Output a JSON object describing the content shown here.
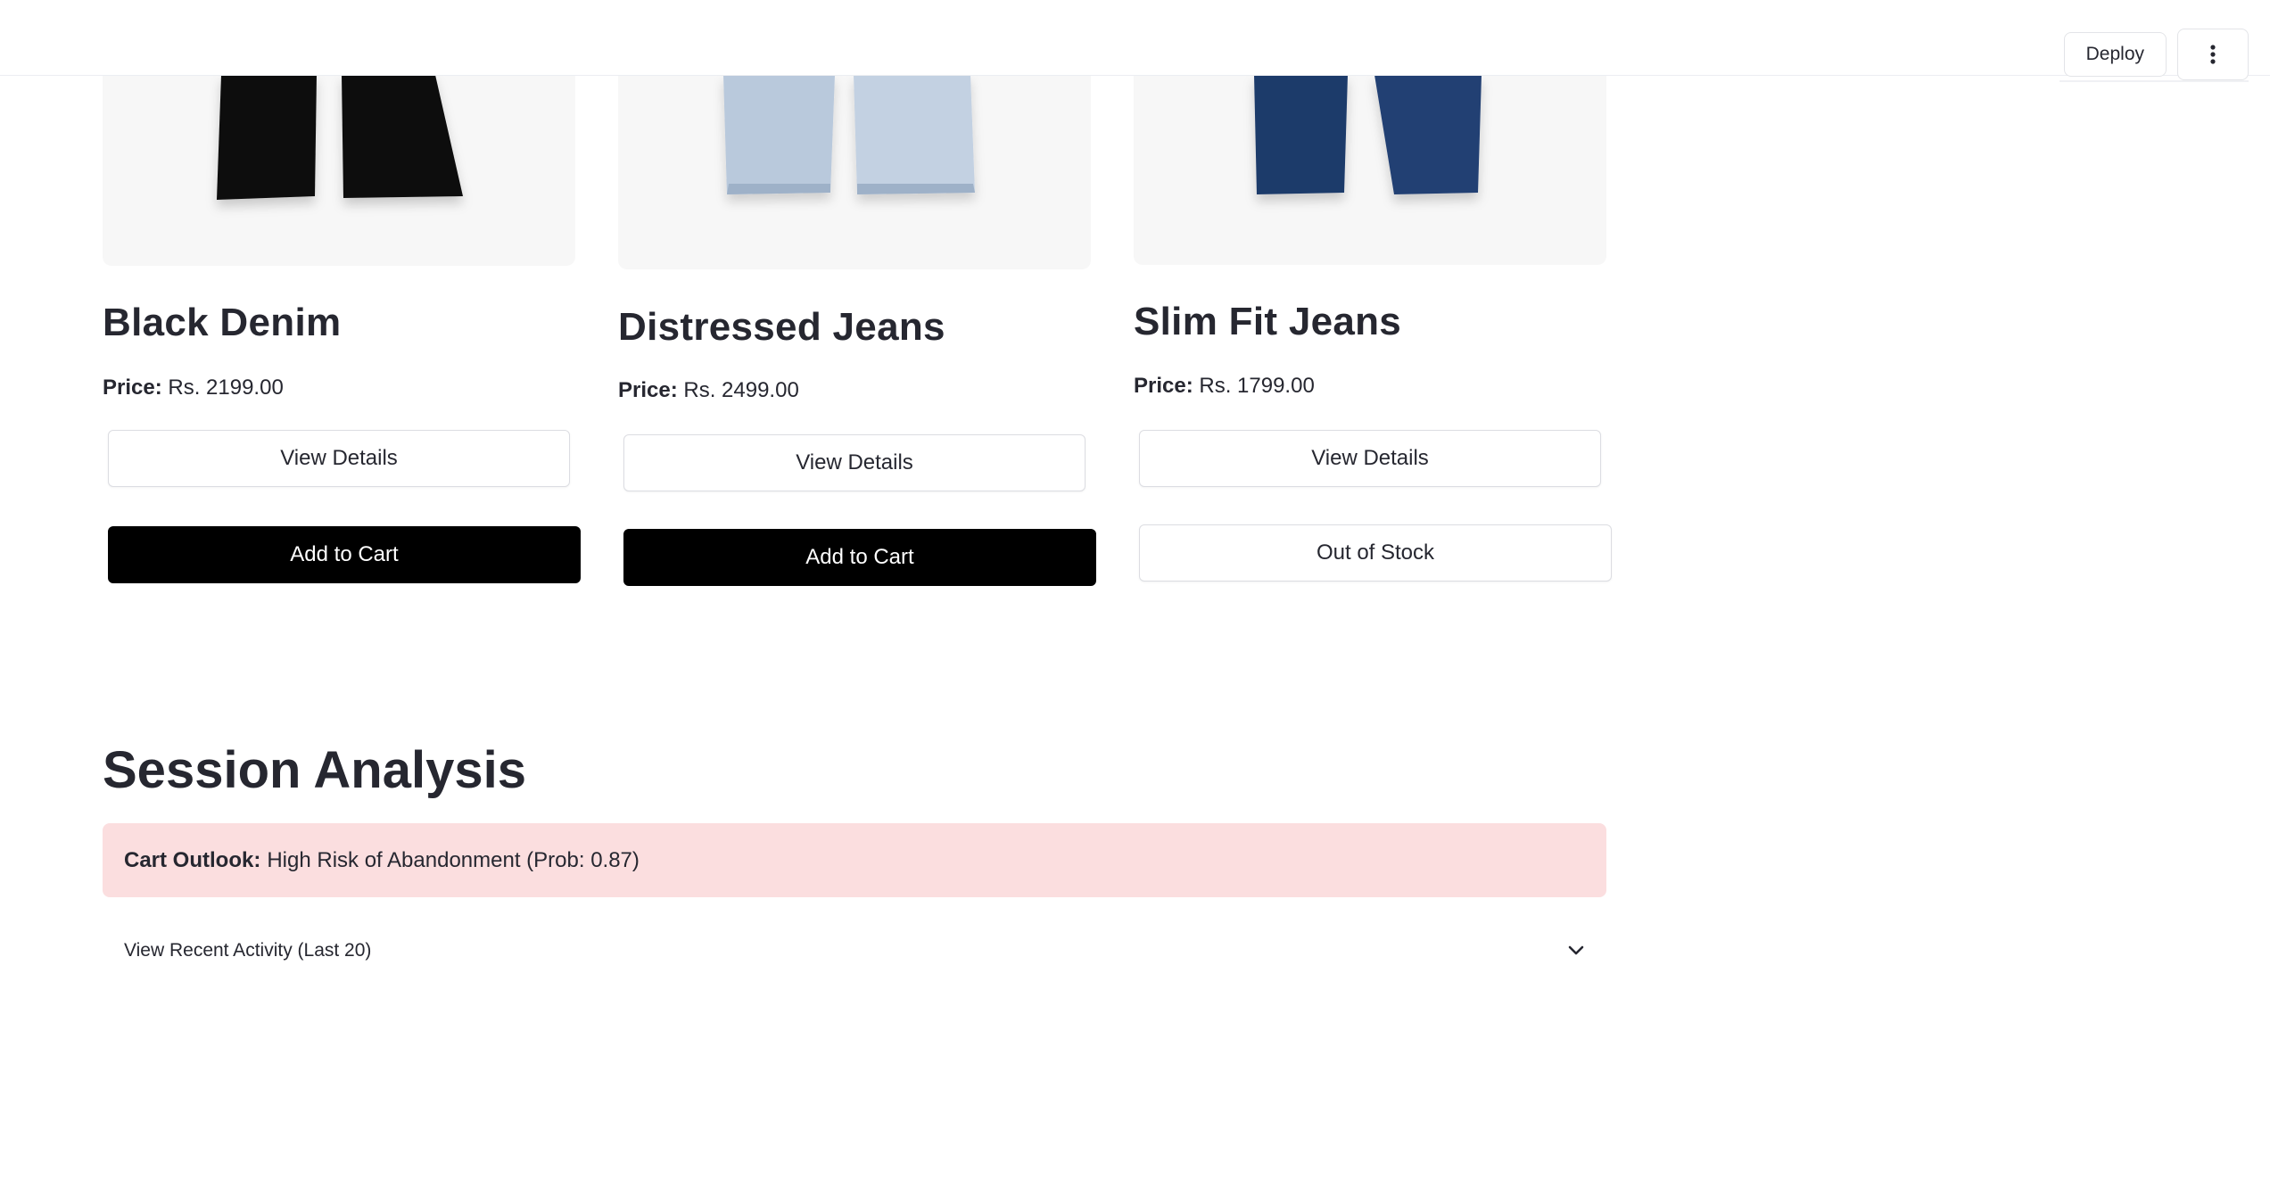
{
  "header": {
    "deploy_label": "Deploy",
    "menu_icon": "vertical-ellipsis-icon"
  },
  "products": [
    {
      "name": "Black Denim",
      "price_label": "Price:",
      "price_value": "Rs. 2199.00",
      "view_label": "View Details",
      "action_label": "Add to Cart",
      "action_style": "primary",
      "jeans_color": "#111111"
    },
    {
      "name": "Distressed Jeans",
      "price_label": "Price:",
      "price_value": "Rs. 2499.00",
      "view_label": "View Details",
      "action_label": "Add to Cart",
      "action_style": "primary",
      "jeans_color": "#b9c9dc"
    },
    {
      "name": "Slim Fit Jeans",
      "price_label": "Price:",
      "price_value": "Rs. 1799.00",
      "view_label": "View Details",
      "action_label": "Out of Stock",
      "action_style": "secondary",
      "jeans_color": "#1f3a6b"
    }
  ],
  "session": {
    "title": "Session Analysis",
    "alert_label": "Cart Outlook:",
    "alert_text": "High Risk of Abandonment (Prob: 0.87)",
    "alert_color": "#fbdedf",
    "expander_label": "View Recent Activity (Last 20)",
    "expander_icon": "chevron-down-icon"
  }
}
